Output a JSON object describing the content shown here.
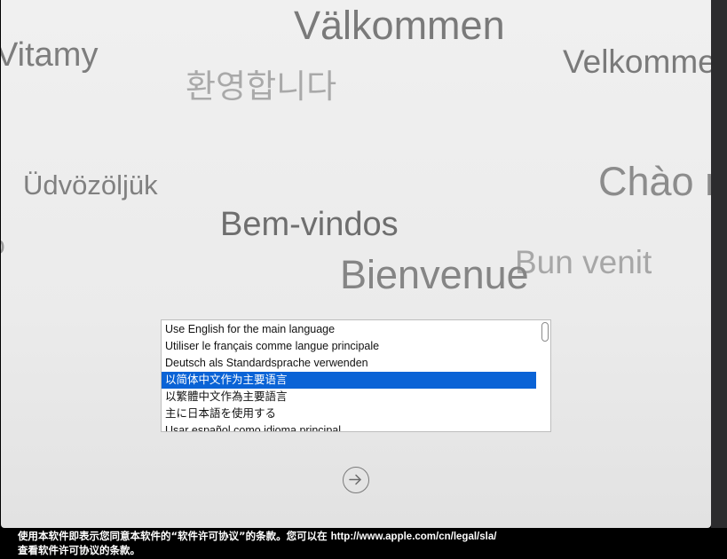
{
  "greetings": {
    "valkommen": "Välkommen",
    "vitamy": "Vitamy",
    "velkommen": "Velkommen",
    "korean": "환영합니다",
    "udvozoljuk": "Üdvözöljük",
    "chao": "Chào mừng",
    "bem_vindos": "Bem-vindos",
    "bun_venit": "Bun venit",
    "bienvenue": "Bienvenue",
    "partial_o": "o"
  },
  "language_list": {
    "items": [
      "Use English for the main language",
      "Utiliser le français comme langue principale",
      "Deutsch als Standardsprache verwenden",
      "以简体中文作为主要语言",
      "以繁體中文作為主要語言",
      "主に日本語を使用する",
      "Usar español como idioma principal"
    ],
    "selected_index": 3
  },
  "next_button": {
    "icon": "arrow-right-circle-icon"
  },
  "footer": {
    "line1": "使用本软件即表示您同意本软件的“软件许可协议”的条款。您可以在 ",
    "url": "http://www.apple.com/cn/legal/sla/",
    "line2": "查看软件许可协议的条款。"
  },
  "colors": {
    "selection": "#0a63d6",
    "window_bg": "#ebebeb",
    "backdrop": "#000000"
  }
}
